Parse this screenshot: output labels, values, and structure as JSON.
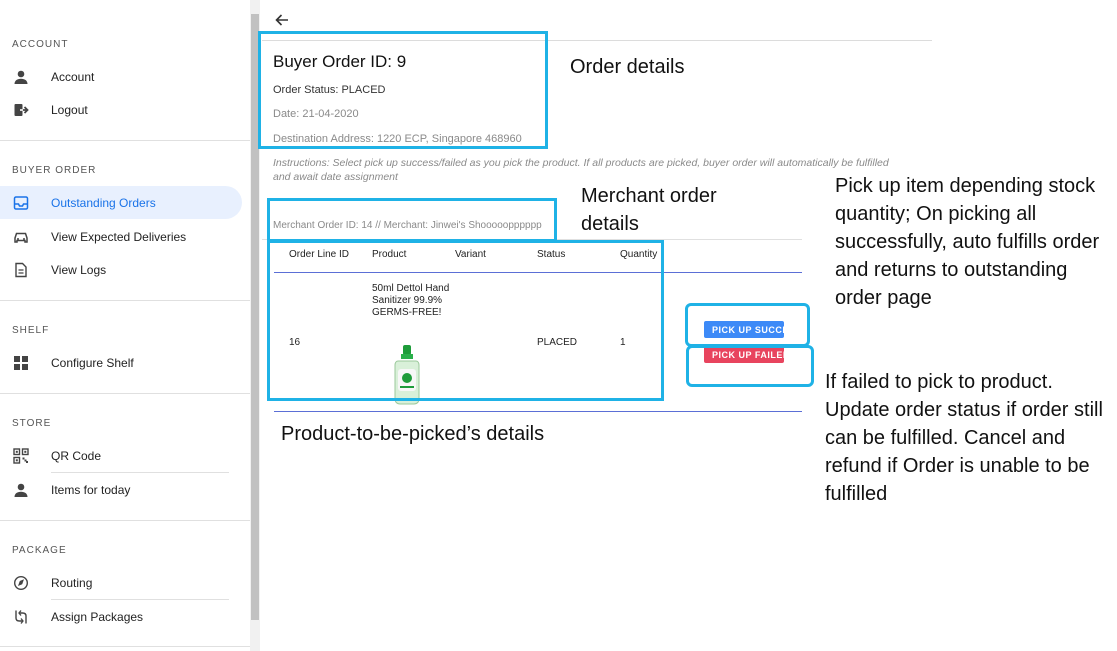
{
  "sidebar": {
    "sections": [
      {
        "title": "ACCOUNT",
        "items": [
          {
            "label": "Account",
            "icon": "person-icon"
          },
          {
            "label": "Logout",
            "icon": "logout-icon"
          }
        ]
      },
      {
        "title": "BUYER ORDER",
        "items": [
          {
            "label": "Outstanding Orders",
            "icon": "inbox-icon",
            "active": true
          },
          {
            "label": "View Expected Deliveries",
            "icon": "car-icon"
          },
          {
            "label": "View Logs",
            "icon": "document-icon"
          }
        ]
      },
      {
        "title": "SHELF",
        "items": [
          {
            "label": "Configure Shelf",
            "icon": "grid-icon"
          }
        ]
      },
      {
        "title": "STORE",
        "items": [
          {
            "label": "QR Code",
            "icon": "qr-code-icon"
          },
          {
            "label": "Items for today",
            "icon": "person-icon"
          }
        ]
      },
      {
        "title": "PACKAGE",
        "items": [
          {
            "label": "Routing",
            "icon": "navigation-icon"
          },
          {
            "label": "Assign Packages",
            "icon": "route-icon"
          }
        ]
      }
    ]
  },
  "order": {
    "title": "Buyer Order ID: 9",
    "status": "Order Status: PLACED",
    "date": "Date: 21-04-2020",
    "address": "Destination Address: 1220 ECP, Singapore 468960"
  },
  "instructions": "Instructions: Select pick up success/failed as you pick the product. If all products are picked, buyer order will automatically be fulfilled and await date assignment",
  "merchant_order": "Merchant Order ID: 14 // Merchant: Jinwei's Shooooopppppp",
  "table": {
    "columns": [
      "Order Line ID",
      "Product",
      "Variant",
      "Status",
      "Quantity"
    ],
    "rows": [
      {
        "order_line_id": "16",
        "product": "50ml Dettol Hand Sanitizer 99.9% GERMS-FREE!",
        "variant": "",
        "status": "PLACED",
        "quantity": "1"
      }
    ]
  },
  "buttons": {
    "success": "PICK UP SUCCESS",
    "failed": "PICK UP FAILED"
  },
  "annotations": {
    "order_details": "Order details",
    "merchant_details": "Merchant order details",
    "product_details": "Product-to-be-picked’s details",
    "pick_up_note": "Pick up item depending stock quantity; On picking all successfully, auto fulfills order and returns to outstanding order page",
    "failed_note": "If failed to pick to product. Update order status if order still can be fulfilled. Cancel and refund if Order is unable to be fulfilled"
  },
  "colors": {
    "accent": "#1a73e8",
    "active_bg": "#e8f0fe",
    "success_button": "#3d8af7",
    "failed_button": "#e8445e",
    "highlight_box": "#1fb2e6"
  }
}
